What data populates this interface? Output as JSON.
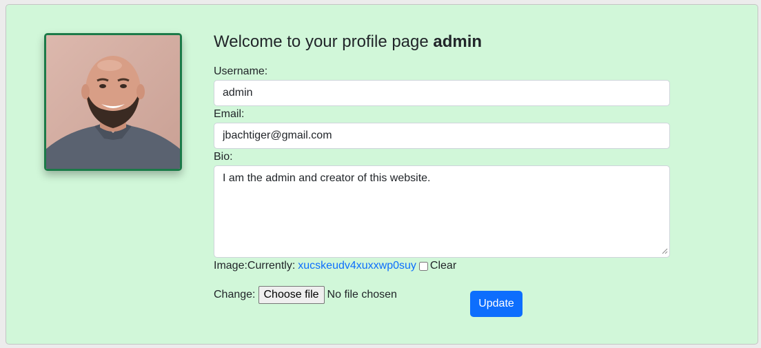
{
  "profile": {
    "title_prefix": "Welcome to your profile page ",
    "title_username": "admin",
    "avatar_icon": "profile-photo"
  },
  "form": {
    "username_label": "Username:",
    "username_value": "admin",
    "email_label": "Email:",
    "email_value": "jbachtiger@gmail.com",
    "bio_label": "Bio:",
    "bio_value": "I am the admin and creator of this website.",
    "image_label": "Image:",
    "currently_label": "Currently:",
    "current_file": "xucskeudv4xuxxwp0suy",
    "clear_label": "Clear",
    "change_label": "Change:",
    "choose_file_label": "Choose file",
    "no_file_text": "No file chosen",
    "update_label": "Update"
  },
  "colors": {
    "card_background": "#d1f7d9",
    "avatar_border": "#1b7a48",
    "primary_button": "#0d6efd",
    "link": "#0d6efd"
  }
}
